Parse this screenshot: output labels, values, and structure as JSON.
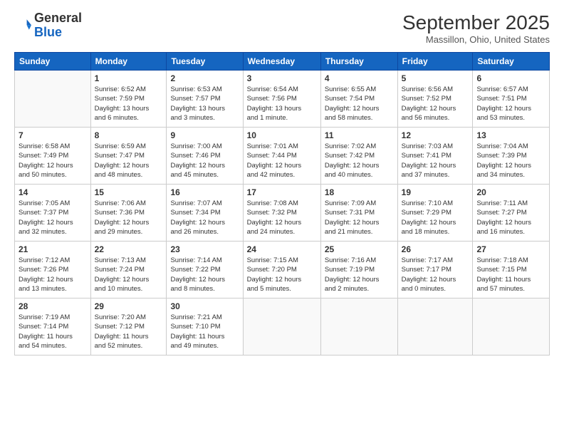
{
  "logo": {
    "general": "General",
    "blue": "Blue"
  },
  "title": "September 2025",
  "location": "Massillon, Ohio, United States",
  "days_header": [
    "Sunday",
    "Monday",
    "Tuesday",
    "Wednesday",
    "Thursday",
    "Friday",
    "Saturday"
  ],
  "weeks": [
    [
      {
        "day": "",
        "info": ""
      },
      {
        "day": "1",
        "info": "Sunrise: 6:52 AM\nSunset: 7:59 PM\nDaylight: 13 hours\nand 6 minutes."
      },
      {
        "day": "2",
        "info": "Sunrise: 6:53 AM\nSunset: 7:57 PM\nDaylight: 13 hours\nand 3 minutes."
      },
      {
        "day": "3",
        "info": "Sunrise: 6:54 AM\nSunset: 7:56 PM\nDaylight: 13 hours\nand 1 minute."
      },
      {
        "day": "4",
        "info": "Sunrise: 6:55 AM\nSunset: 7:54 PM\nDaylight: 12 hours\nand 58 minutes."
      },
      {
        "day": "5",
        "info": "Sunrise: 6:56 AM\nSunset: 7:52 PM\nDaylight: 12 hours\nand 56 minutes."
      },
      {
        "day": "6",
        "info": "Sunrise: 6:57 AM\nSunset: 7:51 PM\nDaylight: 12 hours\nand 53 minutes."
      }
    ],
    [
      {
        "day": "7",
        "info": "Sunrise: 6:58 AM\nSunset: 7:49 PM\nDaylight: 12 hours\nand 50 minutes."
      },
      {
        "day": "8",
        "info": "Sunrise: 6:59 AM\nSunset: 7:47 PM\nDaylight: 12 hours\nand 48 minutes."
      },
      {
        "day": "9",
        "info": "Sunrise: 7:00 AM\nSunset: 7:46 PM\nDaylight: 12 hours\nand 45 minutes."
      },
      {
        "day": "10",
        "info": "Sunrise: 7:01 AM\nSunset: 7:44 PM\nDaylight: 12 hours\nand 42 minutes."
      },
      {
        "day": "11",
        "info": "Sunrise: 7:02 AM\nSunset: 7:42 PM\nDaylight: 12 hours\nand 40 minutes."
      },
      {
        "day": "12",
        "info": "Sunrise: 7:03 AM\nSunset: 7:41 PM\nDaylight: 12 hours\nand 37 minutes."
      },
      {
        "day": "13",
        "info": "Sunrise: 7:04 AM\nSunset: 7:39 PM\nDaylight: 12 hours\nand 34 minutes."
      }
    ],
    [
      {
        "day": "14",
        "info": "Sunrise: 7:05 AM\nSunset: 7:37 PM\nDaylight: 12 hours\nand 32 minutes."
      },
      {
        "day": "15",
        "info": "Sunrise: 7:06 AM\nSunset: 7:36 PM\nDaylight: 12 hours\nand 29 minutes."
      },
      {
        "day": "16",
        "info": "Sunrise: 7:07 AM\nSunset: 7:34 PM\nDaylight: 12 hours\nand 26 minutes."
      },
      {
        "day": "17",
        "info": "Sunrise: 7:08 AM\nSunset: 7:32 PM\nDaylight: 12 hours\nand 24 minutes."
      },
      {
        "day": "18",
        "info": "Sunrise: 7:09 AM\nSunset: 7:31 PM\nDaylight: 12 hours\nand 21 minutes."
      },
      {
        "day": "19",
        "info": "Sunrise: 7:10 AM\nSunset: 7:29 PM\nDaylight: 12 hours\nand 18 minutes."
      },
      {
        "day": "20",
        "info": "Sunrise: 7:11 AM\nSunset: 7:27 PM\nDaylight: 12 hours\nand 16 minutes."
      }
    ],
    [
      {
        "day": "21",
        "info": "Sunrise: 7:12 AM\nSunset: 7:26 PM\nDaylight: 12 hours\nand 13 minutes."
      },
      {
        "day": "22",
        "info": "Sunrise: 7:13 AM\nSunset: 7:24 PM\nDaylight: 12 hours\nand 10 minutes."
      },
      {
        "day": "23",
        "info": "Sunrise: 7:14 AM\nSunset: 7:22 PM\nDaylight: 12 hours\nand 8 minutes."
      },
      {
        "day": "24",
        "info": "Sunrise: 7:15 AM\nSunset: 7:20 PM\nDaylight: 12 hours\nand 5 minutes."
      },
      {
        "day": "25",
        "info": "Sunrise: 7:16 AM\nSunset: 7:19 PM\nDaylight: 12 hours\nand 2 minutes."
      },
      {
        "day": "26",
        "info": "Sunrise: 7:17 AM\nSunset: 7:17 PM\nDaylight: 12 hours\nand 0 minutes."
      },
      {
        "day": "27",
        "info": "Sunrise: 7:18 AM\nSunset: 7:15 PM\nDaylight: 11 hours\nand 57 minutes."
      }
    ],
    [
      {
        "day": "28",
        "info": "Sunrise: 7:19 AM\nSunset: 7:14 PM\nDaylight: 11 hours\nand 54 minutes."
      },
      {
        "day": "29",
        "info": "Sunrise: 7:20 AM\nSunset: 7:12 PM\nDaylight: 11 hours\nand 52 minutes."
      },
      {
        "day": "30",
        "info": "Sunrise: 7:21 AM\nSunset: 7:10 PM\nDaylight: 11 hours\nand 49 minutes."
      },
      {
        "day": "",
        "info": ""
      },
      {
        "day": "",
        "info": ""
      },
      {
        "day": "",
        "info": ""
      },
      {
        "day": "",
        "info": ""
      }
    ]
  ]
}
